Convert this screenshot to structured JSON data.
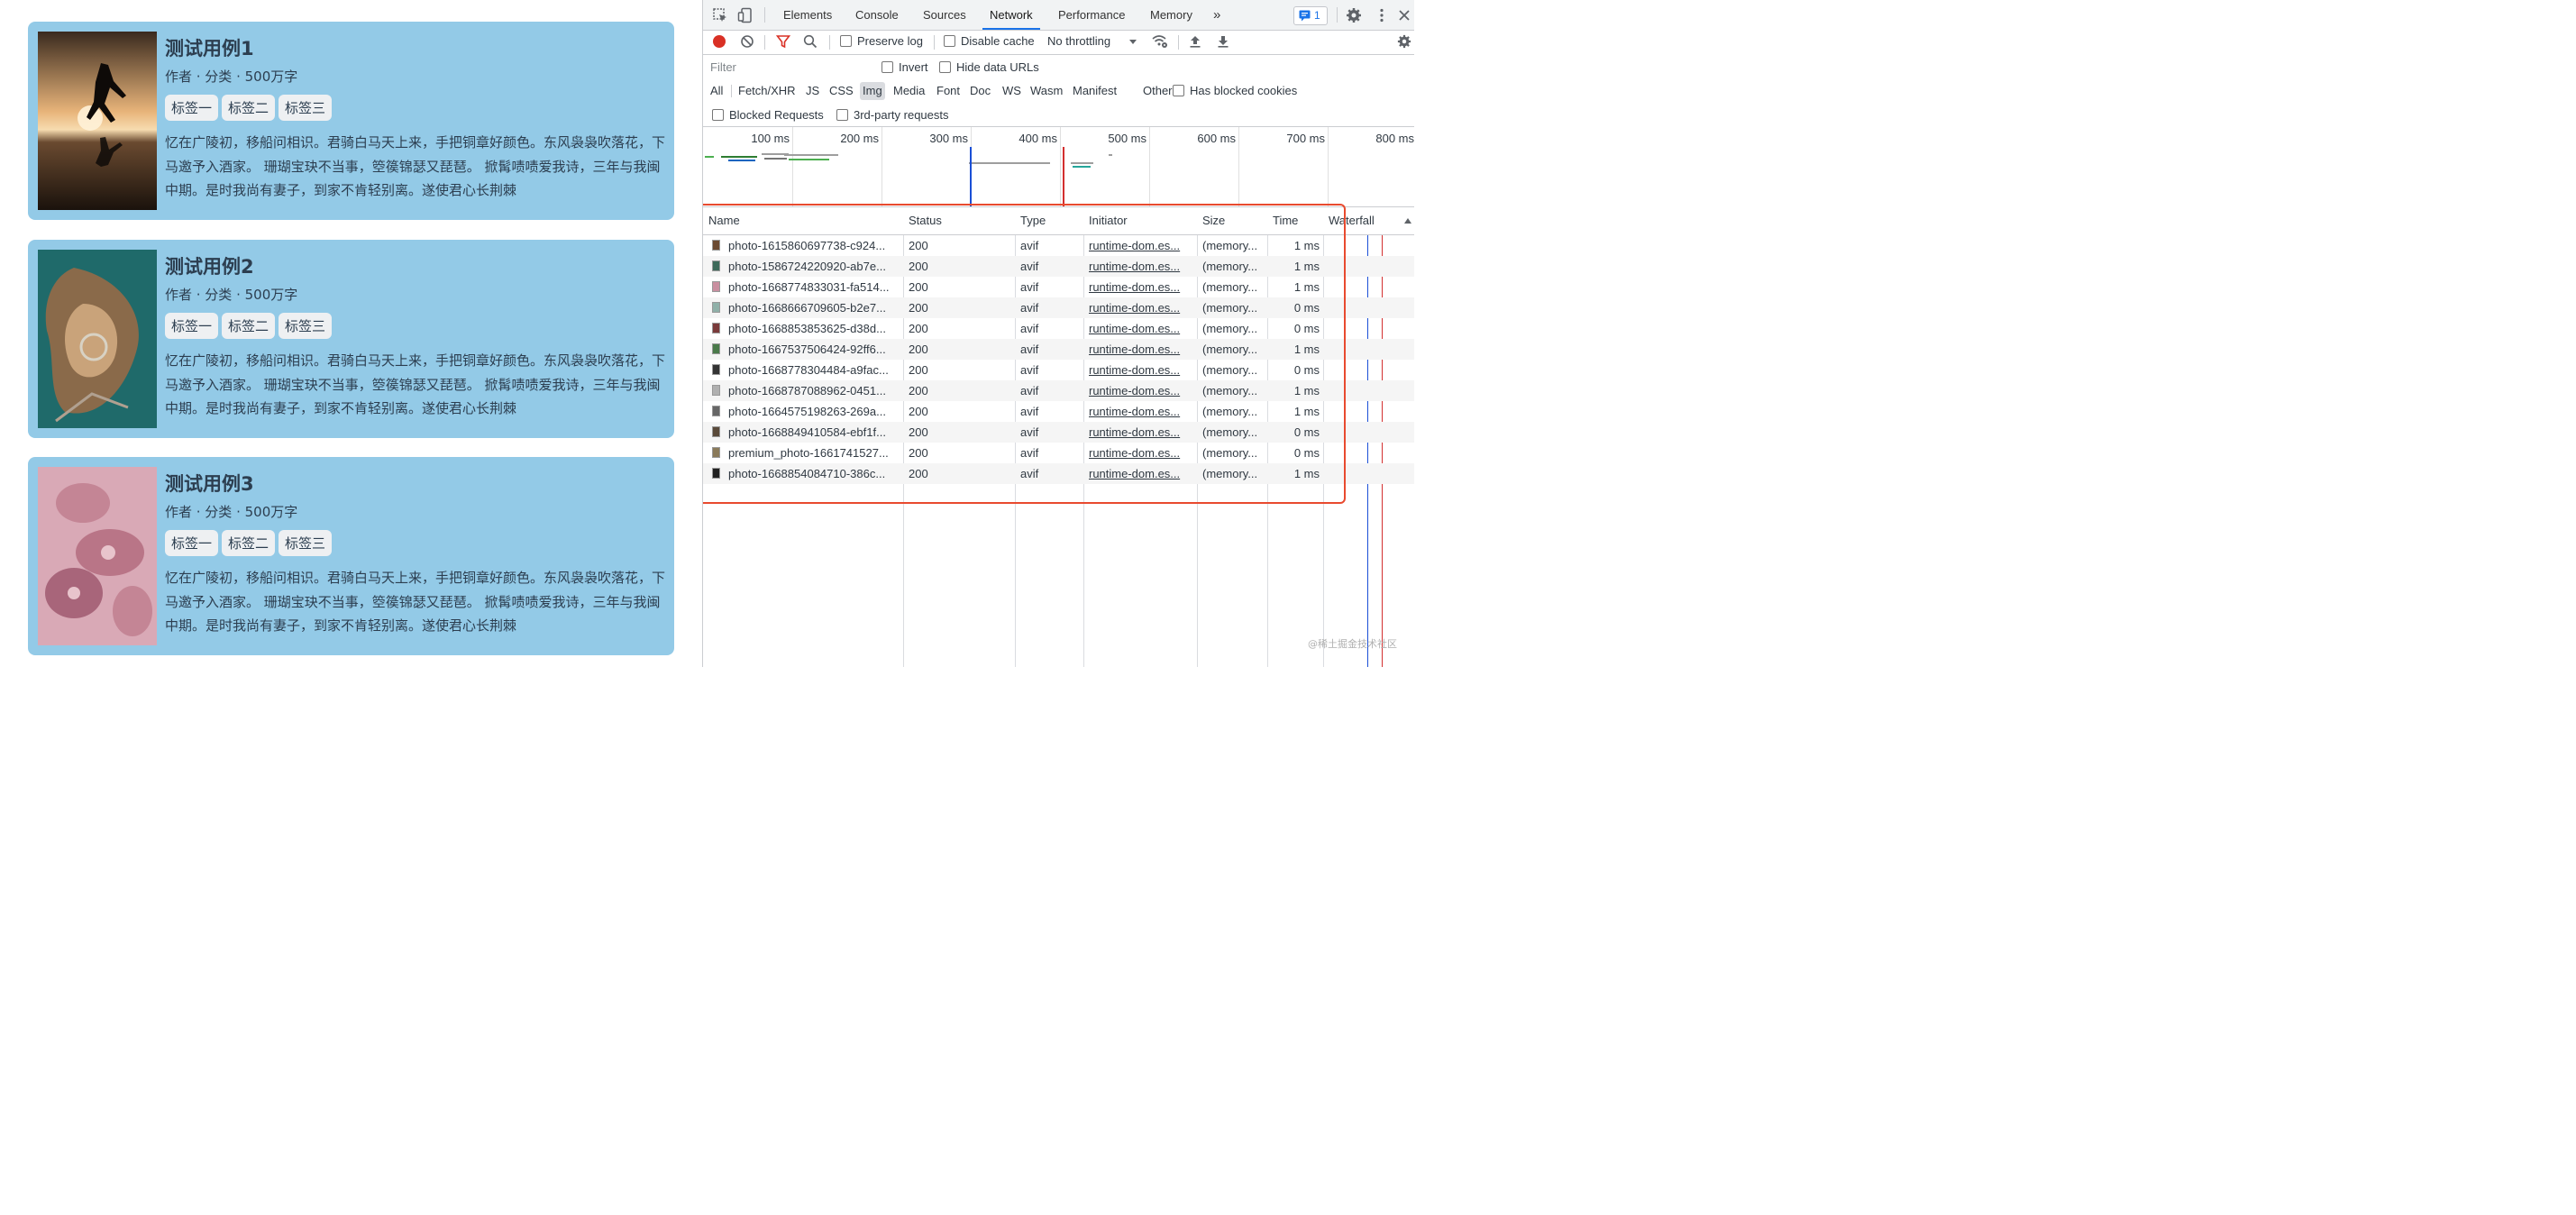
{
  "cards": [
    {
      "title": "测试用例1",
      "meta": "作者 · 分类 · 500万字",
      "tags": [
        "标签一",
        "标签二",
        "标签三"
      ],
      "desc": "忆在广陵初，移船问相识。君骑白马天上来，手把铜章好颜色。东风袅袅吹落花，下马邀予入酒家。 珊瑚宝玦不当事，箜篌锦瑟又琵琶。 掀髯啧啧爱我诗，三年与我闽中期。是时我尚有妻子，到家不肯轻别离。遂使君心长荆棘"
    },
    {
      "title": "测试用例2",
      "meta": "作者 · 分类 · 500万字",
      "tags": [
        "标签一",
        "标签二",
        "标签三"
      ],
      "desc": "忆在广陵初，移船问相识。君骑白马天上来，手把铜章好颜色。东风袅袅吹落花，下马邀予入酒家。 珊瑚宝玦不当事，箜篌锦瑟又琵琶。 掀髯啧啧爱我诗，三年与我闽中期。是时我尚有妻子，到家不肯轻别离。遂使君心长荆棘"
    },
    {
      "title": "测试用例3",
      "meta": "作者 · 分类 · 500万字",
      "tags": [
        "标签一",
        "标签二",
        "标签三"
      ],
      "desc": "忆在广陵初，移船问相识。君骑白马天上来，手把铜章好颜色。东风袅袅吹落花，下马邀予入酒家。 珊瑚宝玦不当事，箜篌锦瑟又琵琶。 掀髯啧啧爱我诗，三年与我闽中期。是时我尚有妻子，到家不肯轻别离。遂使君心长荆棘"
    }
  ],
  "devtools": {
    "tabs": [
      "Elements",
      "Console",
      "Sources",
      "Network",
      "Performance",
      "Memory"
    ],
    "active_tab": "Network",
    "more_tabs_icon": "»",
    "issues_count": "1",
    "toolbar": {
      "preserve_log": "Preserve log",
      "disable_cache": "Disable cache",
      "throttling": "No throttling"
    },
    "filter": {
      "placeholder": "Filter",
      "invert": "Invert",
      "hide_data_urls": "Hide data URLs"
    },
    "types": [
      "All",
      "Fetch/XHR",
      "JS",
      "CSS",
      "Img",
      "Media",
      "Font",
      "Doc",
      "WS",
      "Wasm",
      "Manifest",
      "Other"
    ],
    "selected_type": "Img",
    "has_blocked_cookies": "Has blocked cookies",
    "blocked_requests": "Blocked Requests",
    "third_party": "3rd-party requests",
    "overview_ticks": [
      "100 ms",
      "200 ms",
      "300 ms",
      "400 ms",
      "500 ms",
      "600 ms",
      "700 ms",
      "800 ms"
    ],
    "columns": [
      "Name",
      "Status",
      "Type",
      "Initiator",
      "Size",
      "Time",
      "Waterfall"
    ],
    "rows": [
      {
        "name": "photo-1615860697738-c924...",
        "status": "200",
        "type": "avif",
        "initiator": "runtime-dom.es...",
        "size": "(memory...",
        "time": "1 ms"
      },
      {
        "name": "photo-1586724220920-ab7e...",
        "status": "200",
        "type": "avif",
        "initiator": "runtime-dom.es...",
        "size": "(memory...",
        "time": "1 ms"
      },
      {
        "name": "photo-1668774833031-fa514...",
        "status": "200",
        "type": "avif",
        "initiator": "runtime-dom.es...",
        "size": "(memory...",
        "time": "1 ms"
      },
      {
        "name": "photo-1668666709605-b2e7...",
        "status": "200",
        "type": "avif",
        "initiator": "runtime-dom.es...",
        "size": "(memory...",
        "time": "0 ms"
      },
      {
        "name": "photo-1668853853625-d38d...",
        "status": "200",
        "type": "avif",
        "initiator": "runtime-dom.es...",
        "size": "(memory...",
        "time": "0 ms"
      },
      {
        "name": "photo-1667537506424-92ff6...",
        "status": "200",
        "type": "avif",
        "initiator": "runtime-dom.es...",
        "size": "(memory...",
        "time": "1 ms"
      },
      {
        "name": "photo-1668778304484-a9fac...",
        "status": "200",
        "type": "avif",
        "initiator": "runtime-dom.es...",
        "size": "(memory...",
        "time": "0 ms"
      },
      {
        "name": "photo-1668787088962-0451...",
        "status": "200",
        "type": "avif",
        "initiator": "runtime-dom.es...",
        "size": "(memory...",
        "time": "1 ms"
      },
      {
        "name": "photo-1664575198263-269a...",
        "status": "200",
        "type": "avif",
        "initiator": "runtime-dom.es...",
        "size": "(memory...",
        "time": "1 ms"
      },
      {
        "name": "photo-1668849410584-ebf1f...",
        "status": "200",
        "type": "avif",
        "initiator": "runtime-dom.es...",
        "size": "(memory...",
        "time": "0 ms"
      },
      {
        "name": "premium_photo-1661741527...",
        "status": "200",
        "type": "avif",
        "initiator": "runtime-dom.es...",
        "size": "(memory...",
        "time": "0 ms"
      },
      {
        "name": "photo-1668854084710-386c...",
        "status": "200",
        "type": "avif",
        "initiator": "runtime-dom.es...",
        "size": "(memory...",
        "time": "1 ms"
      }
    ]
  },
  "watermark": "@稀土掘金技术社区",
  "colors": {
    "card_bg": "#93cae7",
    "accent": "#1a73e8",
    "highlight": "#e84a2f",
    "record": "#d93025"
  }
}
